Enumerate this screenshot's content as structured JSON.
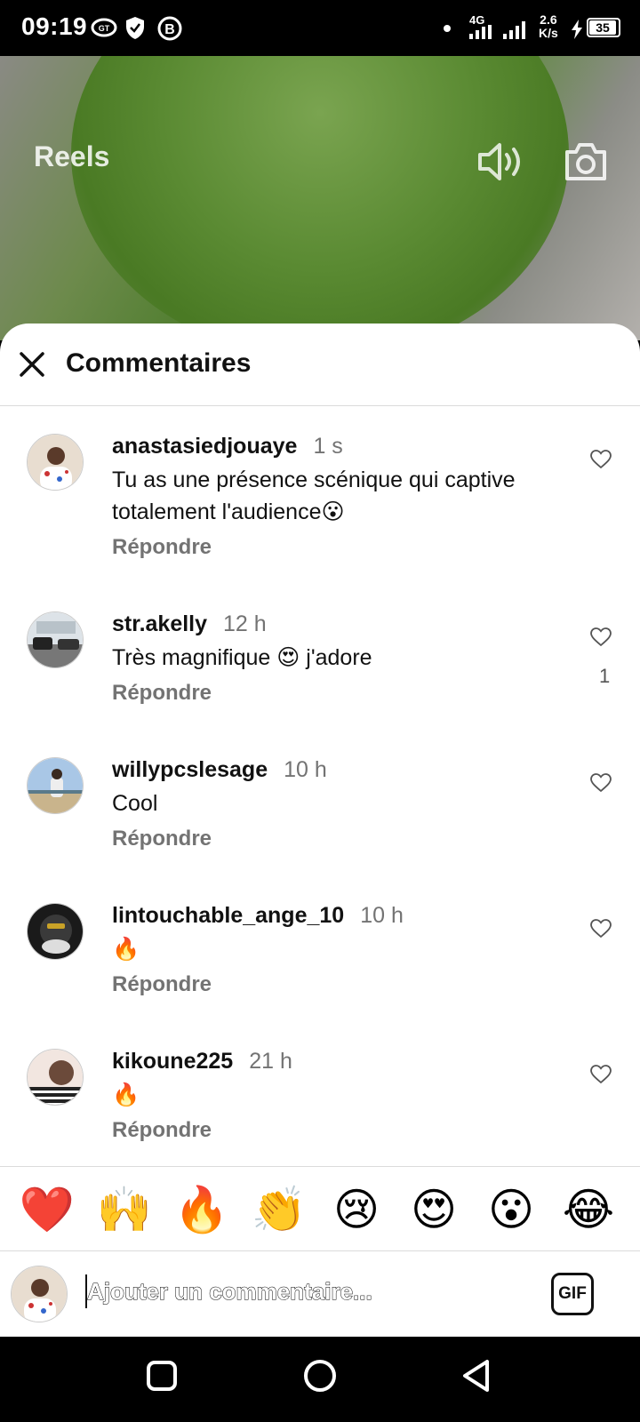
{
  "status_bar": {
    "time": "09:19",
    "network": "4G",
    "speed_value": "2.6",
    "speed_unit": "K/s",
    "battery": "35",
    "icons": [
      "data-saver-icon",
      "shield-icon",
      "b-circle-icon",
      "dot-icon",
      "signal-4g-icon",
      "signal-icon",
      "charging-icon",
      "battery-icon"
    ]
  },
  "reel": {
    "title": "Reels",
    "icons": [
      "speaker-icon",
      "camera-icon"
    ]
  },
  "comments_sheet": {
    "title": "Commentaires",
    "close_icon": "close-icon",
    "reply_label": "Répondre",
    "comments": [
      {
        "username": "anastasiedjouaye",
        "time": "1 s",
        "text": "Tu as une présence scénique qui captive totalement l'audience😮",
        "likes": ""
      },
      {
        "username": "str.akelly",
        "time": "12 h",
        "text": "Très magnifique 😍 j'adore",
        "likes": "1"
      },
      {
        "username": "willypcslesage",
        "time": "10 h",
        "text": "Cool",
        "likes": ""
      },
      {
        "username": "lintouchable_ange_10",
        "time": "10 h",
        "text": "🔥",
        "likes": ""
      },
      {
        "username": "kikoune225",
        "time": "21 h",
        "text": "🔥",
        "likes": ""
      }
    ]
  },
  "emoji_bar": [
    "❤️",
    "🙌",
    "🔥",
    "👏",
    "😢",
    "😍",
    "😮",
    "😂"
  ],
  "input": {
    "placeholder": "Ajouter un commentaire...",
    "gif_label": "GIF"
  },
  "nav_bar": {
    "icons": [
      "recents-square-icon",
      "home-circle-icon",
      "back-triangle-icon"
    ]
  }
}
